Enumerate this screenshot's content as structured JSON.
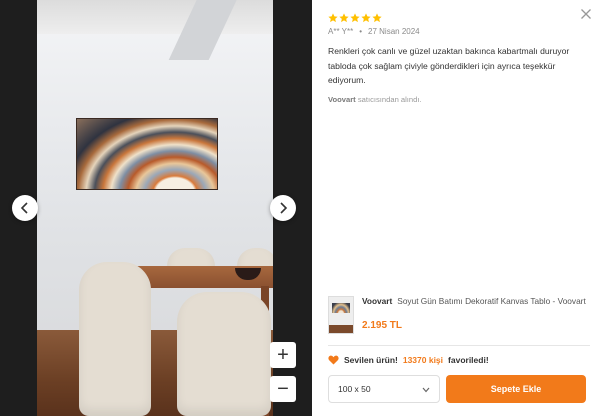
{
  "gallery": {
    "prev_icon": "chevron-left-icon",
    "next_icon": "chevron-right-icon",
    "zoom_in_label": "+",
    "zoom_out_label": "−"
  },
  "review": {
    "rating": 5,
    "author": "A** Y**",
    "separator": "•",
    "date": "27 Nisan 2024",
    "text": "Renkleri çok canlı ve güzel uzaktan bakınca kabartmalı duruyor tabloda çok sağlam çiviyle gönderdikleri için ayrıca teşekkür ediyorum.",
    "seller_name": "Voovart",
    "seller_suffix": "satıcısından alındı."
  },
  "product": {
    "brand": "Voovart",
    "name": "Soyut Gün Batımı Dekoratif Kanvas Tablo - Voovart",
    "price": "2.195 TL"
  },
  "favorites": {
    "prefix": "Sevilen ürün!",
    "count": "13370 kişi",
    "suffix": "favoriledi!"
  },
  "variant": {
    "selected": "100 x 50"
  },
  "actions": {
    "add_to_cart": "Sepete Ekle"
  },
  "colors": {
    "accent": "#f27a1a",
    "star": "#ffc000",
    "backdrop": "#1e1e1e"
  }
}
